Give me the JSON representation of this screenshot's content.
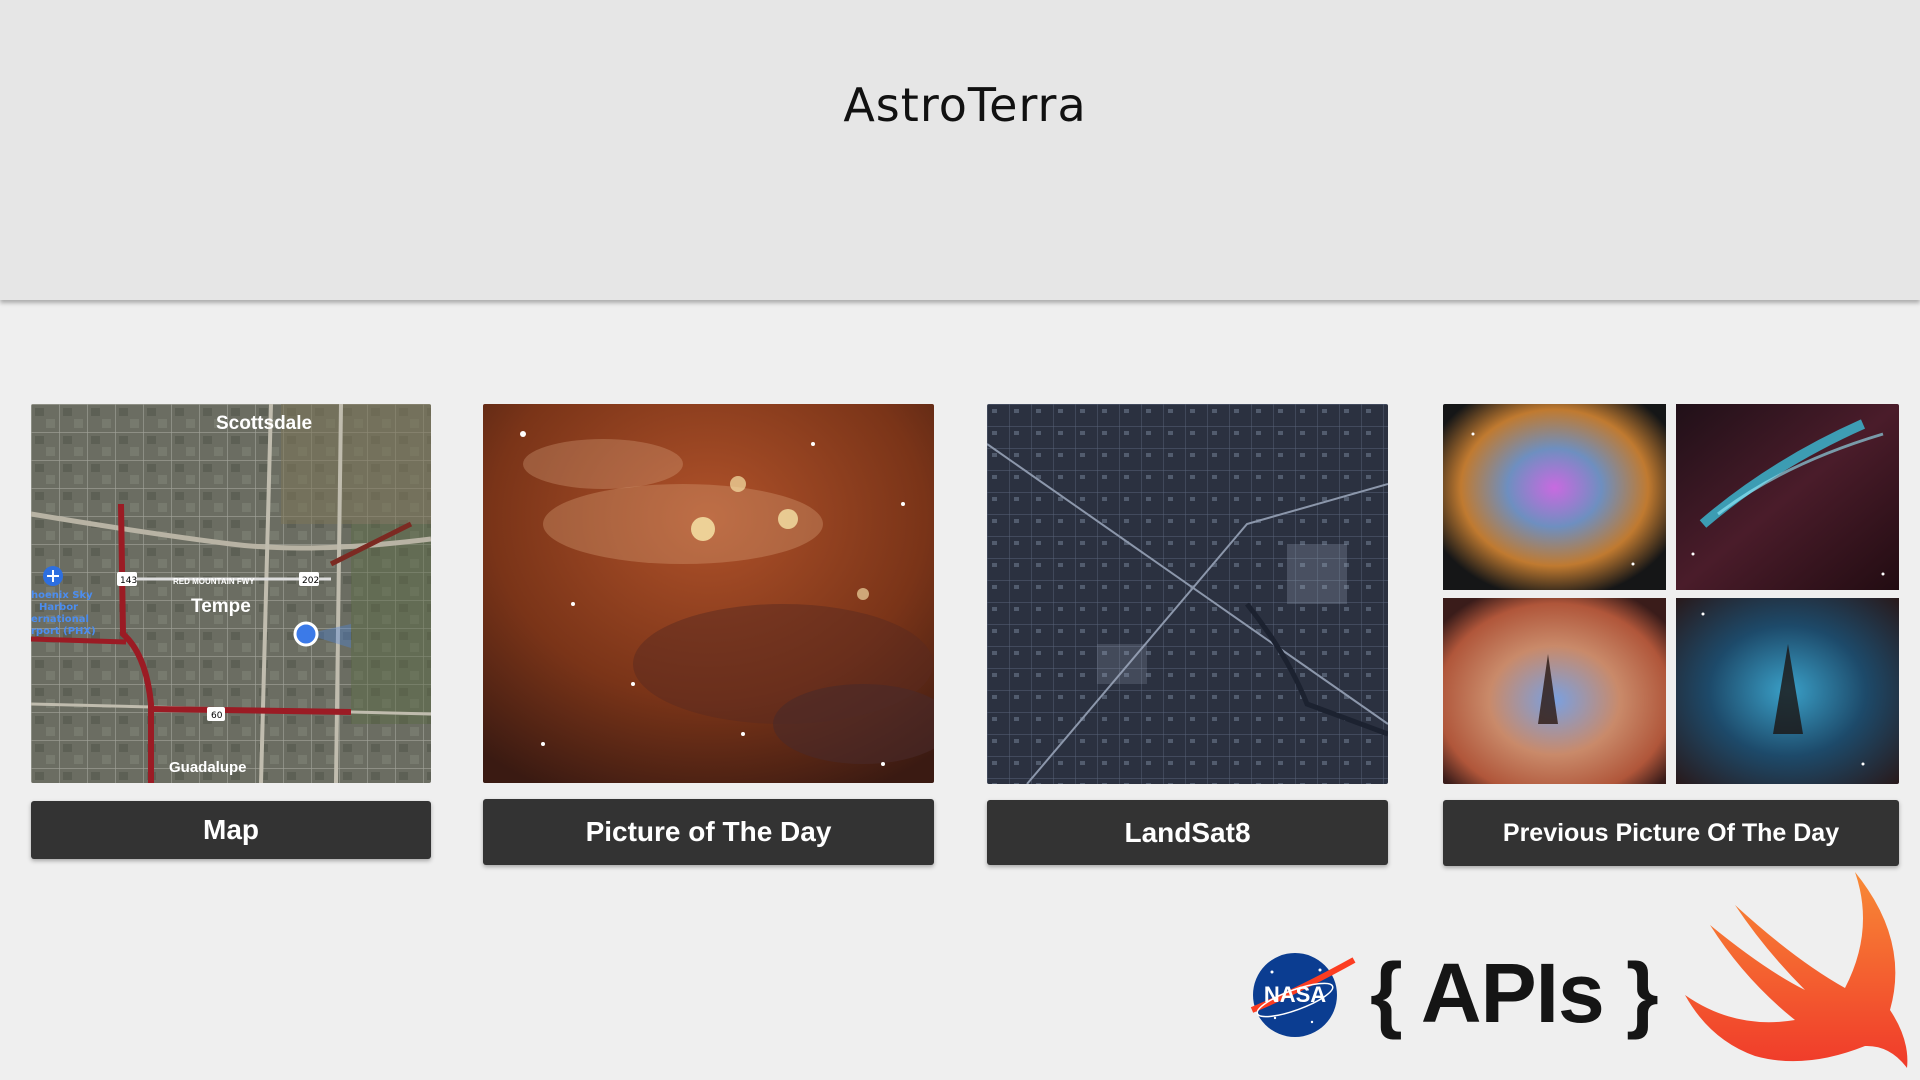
{
  "app": {
    "title": "AstroTerra"
  },
  "tiles": [
    {
      "image": "map-thumbnail",
      "button": "Map"
    },
    {
      "image": "picture-of-the-day-thumbnail",
      "button": "Picture of The Day"
    },
    {
      "image": "landsat8-thumbnail",
      "button": "LandSat8"
    },
    {
      "image": "previous-pictures-collage",
      "button": "Previous Picture Of The Day"
    }
  ],
  "map": {
    "labels": {
      "scottsdale": "Scottsdale",
      "tempe": "Tempe",
      "guadalupe": "Guadalupe",
      "freeway": "RED MOUNTAIN FWY",
      "airport_1": "hoenix Sky",
      "airport_2": "Harbor",
      "airport_3": "ernational",
      "airport_4": "rport (PHX)",
      "route_143": "143",
      "route_202": "202",
      "route_60": "60"
    }
  },
  "footer": {
    "nasa_logo_text": "NASA",
    "apis_text": "{ APIs }",
    "swift_logo": "swift-bird-icon"
  },
  "colors": {
    "header_bg": "#e6e6e6",
    "page_bg": "#efefef",
    "button_bg": "#333333",
    "swift_orange": "#f15a2c"
  }
}
